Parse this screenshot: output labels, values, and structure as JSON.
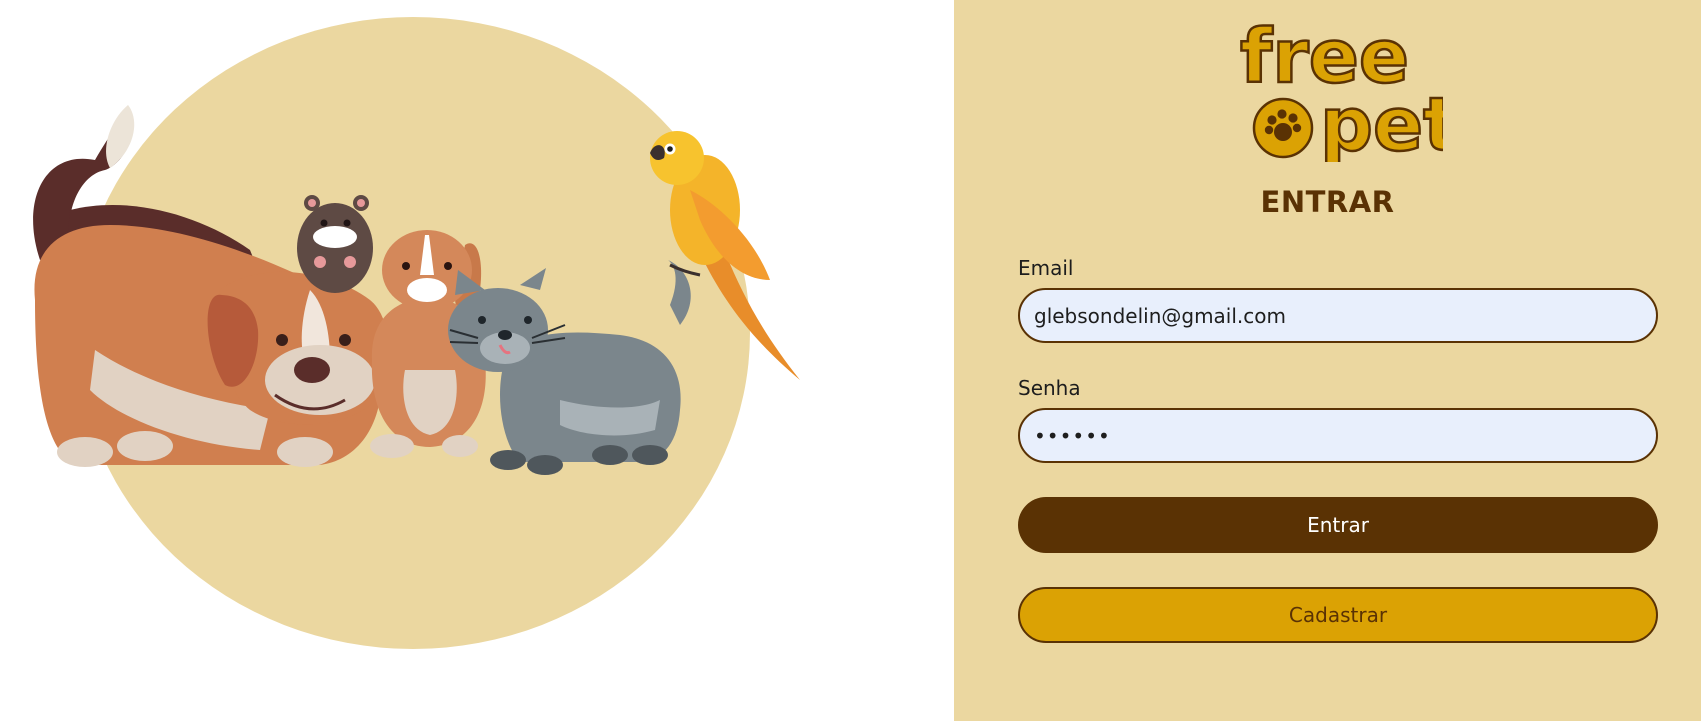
{
  "brand": {
    "line1": "free",
    "line2": "pet"
  },
  "illustration": {
    "animals": [
      "dog",
      "hamster",
      "rabbit",
      "cat",
      "parrot"
    ]
  },
  "login": {
    "heading": "ENTRAR",
    "email_label": "Email",
    "email_value": "glebsondelin@gmail.com",
    "password_label": "Senha",
    "password_value": "••••••",
    "submit_label": "Entrar",
    "register_label": "Cadastrar"
  },
  "colors": {
    "panel_bg": "#ebd7a0",
    "brown": "#5a3204",
    "gold": "#dba204",
    "input_bg": "#e8effc"
  },
  "icons": {
    "logo_mark": "paw-icon"
  }
}
